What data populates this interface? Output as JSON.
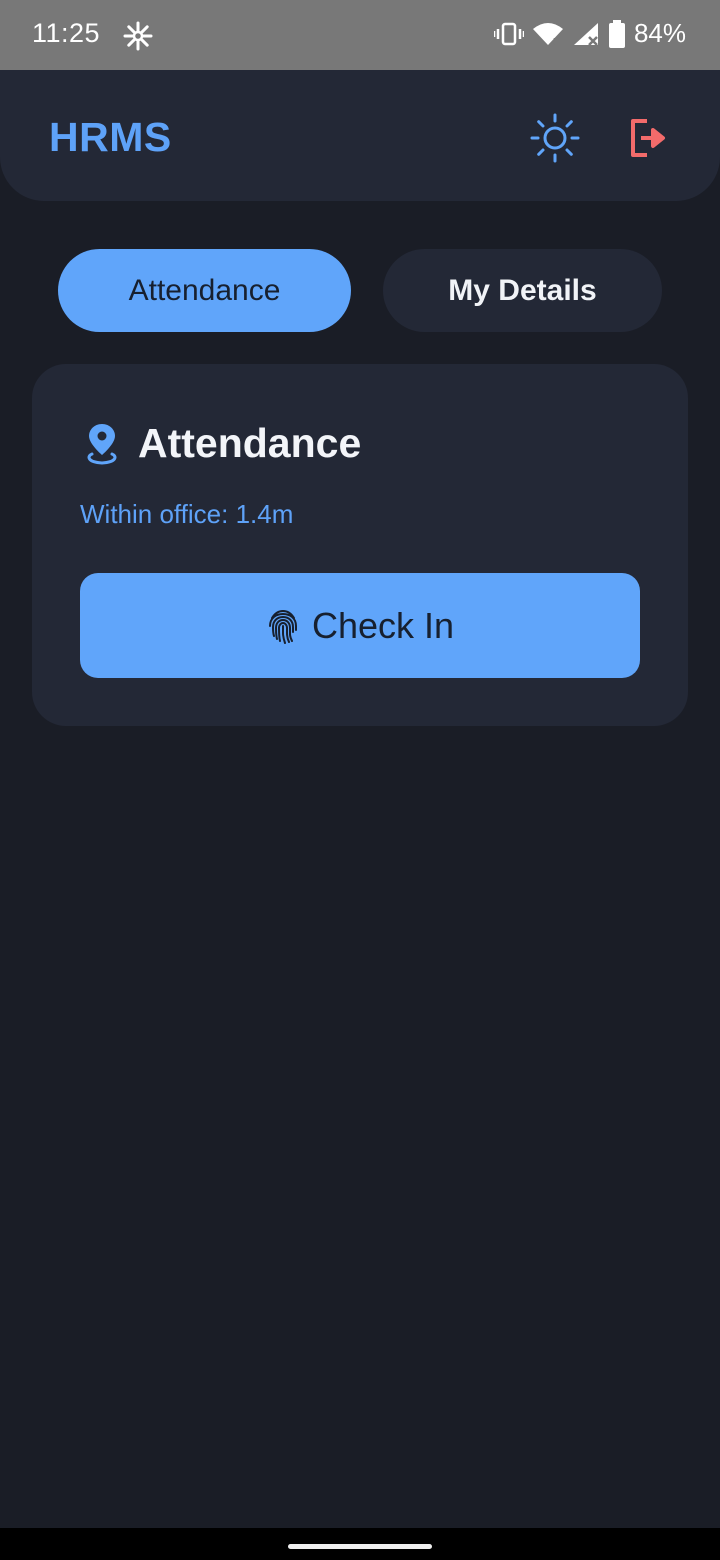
{
  "status_bar": {
    "time": "11:25",
    "battery": "84%",
    "icons": [
      "snowflake-icon",
      "vibrate-icon",
      "wifi-icon",
      "signal-icon",
      "battery-icon"
    ]
  },
  "app_bar": {
    "title": "HRMS",
    "theme_icon": "sun-icon",
    "logout_icon": "logout-icon",
    "accent": "#60a5fa",
    "logout_color": "#f26b6b"
  },
  "tabs": [
    {
      "label": "Attendance",
      "active": true
    },
    {
      "label": "My Details",
      "active": false
    }
  ],
  "attendance_card": {
    "icon": "location-pin-icon",
    "title": "Attendance",
    "status": "Within office: 1.4m",
    "button_icon": "fingerprint-icon",
    "button_label": "Check In"
  },
  "colors": {
    "background": "#1a1d26",
    "surface": "#232836",
    "primary": "#60a5fa"
  }
}
